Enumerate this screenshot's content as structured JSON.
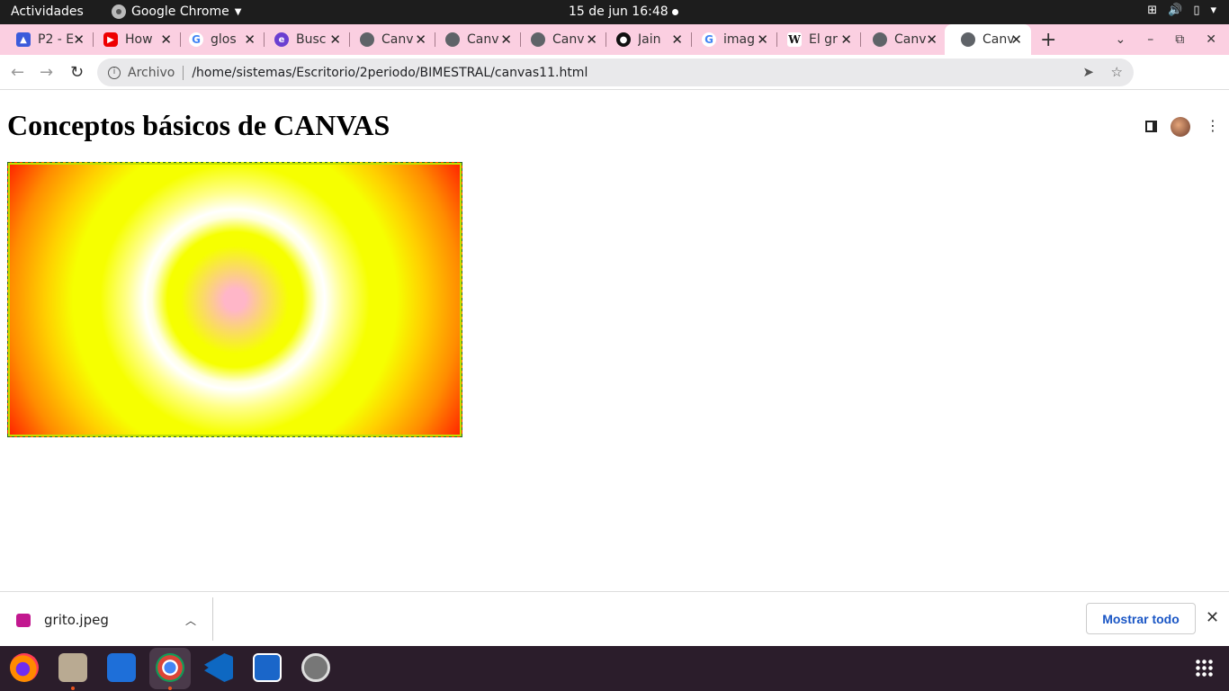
{
  "topbar": {
    "activities": "Actividades",
    "app_name": "Google Chrome",
    "clock": "15 de jun  16:48"
  },
  "tabs": [
    {
      "title": "P2 - E",
      "favicon": "p2-icon"
    },
    {
      "title": "How",
      "favicon": "youtube-icon"
    },
    {
      "title": "glos",
      "favicon": "google-icon"
    },
    {
      "title": "Busc",
      "favicon": "search-site-icon"
    },
    {
      "title": "Canv",
      "favicon": "globe-icon"
    },
    {
      "title": "Canv",
      "favicon": "globe-icon"
    },
    {
      "title": "Canv",
      "favicon": "globe-icon"
    },
    {
      "title": "Jain",
      "favicon": "github-icon"
    },
    {
      "title": "imag",
      "favicon": "google-icon"
    },
    {
      "title": "El gr",
      "favicon": "wikipedia-icon"
    },
    {
      "title": "Canv",
      "favicon": "globe-icon"
    },
    {
      "title": "Canv",
      "favicon": "globe-icon",
      "active": true
    }
  ],
  "toolbar": {
    "site_info": "Archivo",
    "url": "/home/sistemas/Escritorio/2periodo/BIMESTRAL/canvas11.html"
  },
  "page": {
    "title": "Conceptos básicos de CANVAS"
  },
  "download": {
    "filename": "grito.jpeg",
    "show_all": "Mostrar todo"
  },
  "colors": {
    "tabstrip": "#fbcfe1",
    "dock": "#2b1d2b",
    "link_blue": "#1a56c5"
  }
}
